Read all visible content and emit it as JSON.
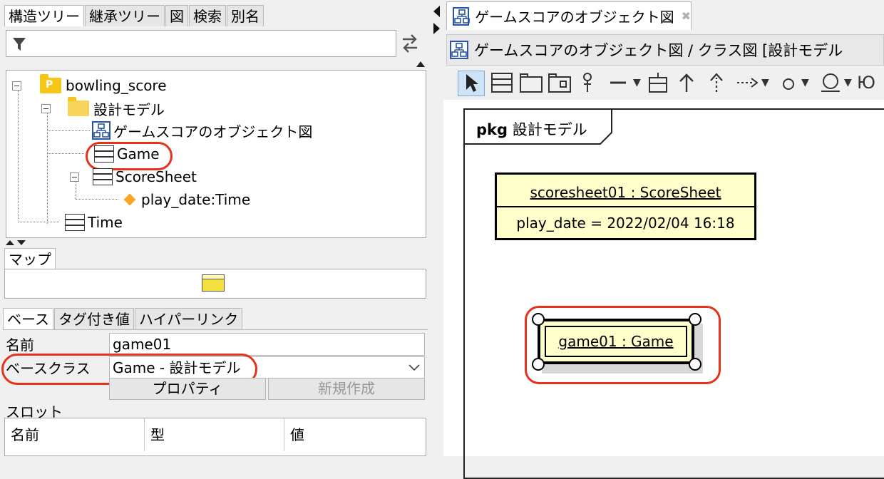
{
  "left_tabs": [
    "構造ツリー",
    "継承ツリー",
    "図",
    "検索",
    "別名"
  ],
  "filter": {
    "placeholder": ""
  },
  "tree": {
    "root": "bowling_score",
    "pkg": "設計モデル",
    "diagram": "ゲームスコアのオブジェクト図",
    "game": "Game",
    "scoresheet": "ScoreSheet",
    "attr": "play_date:Time",
    "time": "Time"
  },
  "map_tab": "マップ",
  "prop_tabs": [
    "ベース",
    "タグ付き値",
    "ハイパーリンク"
  ],
  "props": {
    "name_label": "名前",
    "name_value": "game01",
    "baseclass_label": "ベースクラス",
    "baseclass_value": "Game - 設計モデル",
    "properties_button": "プロパティ",
    "new_button": "新規作成",
    "slot_label": "スロット",
    "slot_columns": [
      "名前",
      "型",
      "値"
    ]
  },
  "editor": {
    "tab_title": "ゲームスコアのオブジェクト図",
    "breadcrumb": "ゲームスコアのオブジェクト図 / クラス図 [設計モデル"
  },
  "diagram": {
    "package_label_kw": "pkg",
    "package_label_name": "設計モデル",
    "scoresheet_title": "scoresheet01 : ScoreSheet",
    "scoresheet_slot": "play_date = 2022/02/04 16:18",
    "game_title": "game01 : Game"
  },
  "colors": {
    "highlight": "#e4321b",
    "object_fill": "#ffffcc",
    "package_icon": "#f5c518"
  }
}
